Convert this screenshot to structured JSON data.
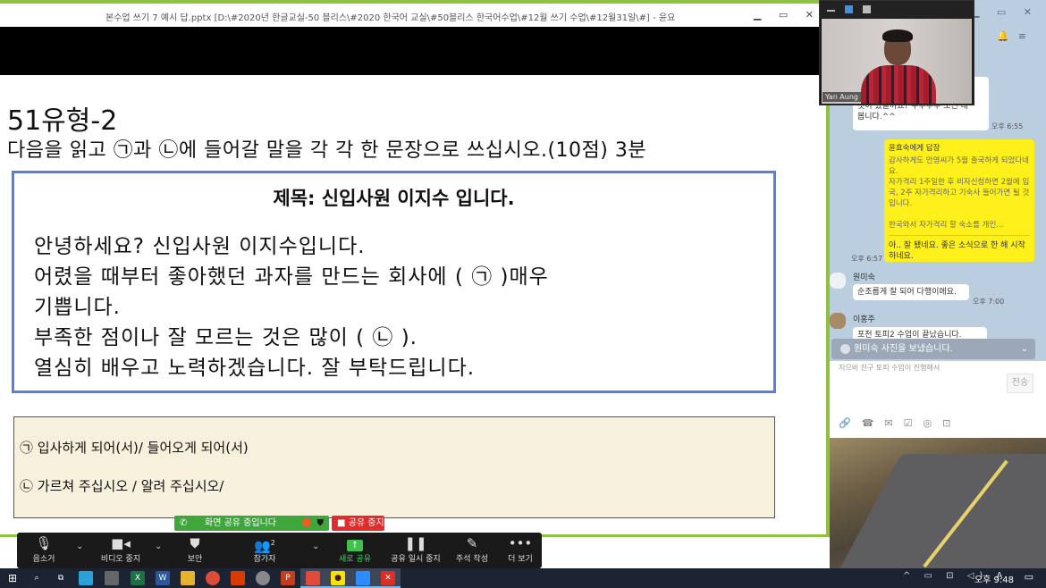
{
  "window": {
    "ppt_title": "본수업 쓰기 7 예시 답.pptx [D:\\#2020년 한글교실-50 블리스\\#2020 한국어 교실\\#50블리스 한국어수업\\#12월 쓰기 수업\\#12월31일\\#] - 윤요",
    "win_controls": "▁ ▭ ✕"
  },
  "slide": {
    "heading": "51유형-2",
    "instruction": "다음을 읽고 ㉠과 ㉡에 들어갈 말을 각 각 한 문장으로 쓰십시오.(10점)   3분",
    "letter_title": "제목: 신입사원 이지수 입니다.",
    "letter_lines": [
      "안녕하세요? 신입사원 이지수입니다.",
      "어렸을 때부터 좋아했던 과자를 만드는 회사에 (        ㉠        )매우",
      "기쁩니다.",
      "부족한 점이나 잘 모르는 것은 많이 (        ㉡        ).",
      "열심히 배우고 노력하겠습니다. 잘 부탁드립니다."
    ],
    "answers": [
      "㉠  입사하게 되어(서)/ 들어오게 되어(서)",
      "㉡  가르쳐 주십시오 / 알려 주십시오/"
    ]
  },
  "share": {
    "status": "화면 공유 중입니다",
    "stop_label": "■ 공유 중지"
  },
  "toolbar": {
    "mute": "음소거",
    "video": "비디오 중지",
    "security": "보안",
    "participants": "참가자",
    "participants_count": "2",
    "new_share": "새로 공유",
    "pause_share": "공유 일시 중지",
    "annotate": "주석 작성",
    "more": "더 보기",
    "icons": {
      "mute": "mic-icon",
      "video": "camera-icon",
      "security": "shield-icon",
      "participants": "people-icon",
      "new_share": "share-arrow-icon",
      "pause_share": "pause-icon",
      "annotate": "pencil-icon",
      "more": "more-icon"
    }
  },
  "video": {
    "participant_name": "Yan Aung"
  },
  "chat": {
    "top_bubble": "이\n을\n것이 있을까요? 두루두루 조언 내\n봅니다.^^",
    "top_time": "오후 6:55",
    "reply_to": "윤효숙에게 답장",
    "reply_quote": "감사하게도 안영씨가 5월 출국하게 되었다네요.\n자가격리 1주일한 후 비자신청하면 2월에 입국, 2주 자가격리하고 기숙사 들어가면 될 것입니다.\n\n한국와서 자가격리 할 숙소를 개인...",
    "reply_text": "아.. 잘 됐네요. 좋은 소식으로 한 해 시작하네요.",
    "reply_time": "오후 6:57",
    "sender1": "원미숙",
    "msg1": "순조롭게 잘 되어 다행이에요.",
    "msg1_time": "오후 7:00",
    "sender2": "이홍주",
    "msg2": "포천 토피2 수업이 끝났습니다.",
    "msg3": "지으비 친구 토피 수업이 진행해서",
    "photo_notice": "원미숙 사진을 보냈습니다.",
    "send_label": "전송"
  },
  "taskbar": {
    "clock": "오후 9:48",
    "tray": "^ ▭ ⊡ ◁) A"
  },
  "colors": {
    "share_green": "#8fc23f",
    "letter_border": "#5b7fd6",
    "answer_bg": "#f6f0dc",
    "stop_red": "#e02c2c",
    "chat_bg": "#bacee0",
    "chat_yellow": "#fef01b"
  }
}
